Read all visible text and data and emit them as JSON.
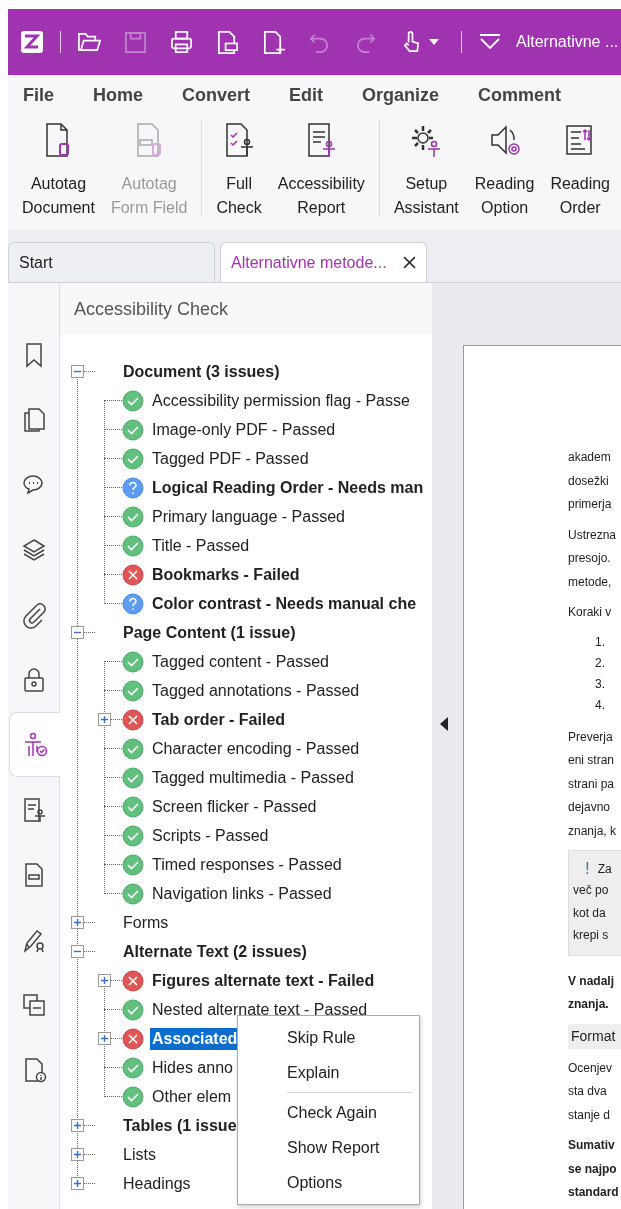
{
  "titlebar": {
    "title": "Alternativne ...",
    "quick_access": [
      {
        "disabled": false
      },
      {
        "disabled": true
      },
      {
        "disabled": false
      },
      {
        "disabled": false
      },
      {
        "disabled": false
      },
      {
        "disabled": true
      },
      {
        "disabled": true
      },
      {
        "disabled": false
      }
    ]
  },
  "menu": [
    "File",
    "Home",
    "Convert",
    "Edit",
    "Organize",
    "Comment"
  ],
  "ribbon": [
    {
      "buttons": [
        {
          "label": "Autotag\nDocument",
          "disabled": false
        },
        {
          "label": "Autotag\nForm Field",
          "disabled": true
        }
      ]
    },
    {
      "buttons": [
        {
          "label": "Full\nCheck",
          "disabled": false
        },
        {
          "label": "Accessibility\nReport",
          "disabled": false
        }
      ]
    },
    {
      "buttons": [
        {
          "label": "Setup\nAssistant",
          "disabled": false
        },
        {
          "label": "Reading\nOption",
          "disabled": false
        },
        {
          "label": "Reading\nOrder",
          "disabled": false
        }
      ]
    }
  ],
  "tabs": [
    {
      "label": "Start",
      "selected": false,
      "closable": false
    },
    {
      "label": "Alternativne metode...",
      "selected": true,
      "closable": true
    }
  ],
  "rail": [
    {
      "selected": false
    },
    {
      "selected": false
    },
    {
      "selected": false
    },
    {
      "selected": false
    },
    {
      "selected": false
    },
    {
      "selected": false
    },
    {
      "selected": true
    },
    {
      "selected": false
    },
    {
      "selected": false
    },
    {
      "selected": false
    },
    {
      "selected": false
    },
    {
      "selected": false
    }
  ],
  "panel": {
    "title": "Accessibility Check",
    "tree": [
      {
        "label": "Document (3 issues)",
        "bold": true,
        "expanded": true,
        "children": [
          {
            "label": "Accessibility permission flag - Passe",
            "kind": "passed",
            "bold": false,
            "selected": false
          },
          {
            "label": "Image-only PDF - Passed",
            "kind": "passed",
            "bold": false,
            "selected": false
          },
          {
            "label": "Tagged PDF - Passed",
            "kind": "passed",
            "bold": false,
            "selected": false
          },
          {
            "label": "Logical Reading Order - Needs man",
            "kind": "manual",
            "bold": true,
            "selected": false
          },
          {
            "label": "Primary language - Passed",
            "kind": "passed",
            "bold": false,
            "selected": false
          },
          {
            "label": "Title - Passed",
            "kind": "passed",
            "bold": false,
            "selected": false
          },
          {
            "label": "Bookmarks - Failed",
            "kind": "failed",
            "bold": true,
            "selected": false
          },
          {
            "label": "Color contrast - Needs manual che",
            "kind": "manual",
            "bold": true,
            "selected": false
          }
        ]
      },
      {
        "label": "Page Content (1 issue)",
        "bold": true,
        "expanded": true,
        "children": [
          {
            "label": "Tagged content - Passed",
            "kind": "passed",
            "bold": false,
            "selected": false
          },
          {
            "label": "Tagged annotations - Passed",
            "kind": "passed",
            "bold": false,
            "selected": false
          },
          {
            "label": "Tab order - Failed",
            "kind": "failed",
            "bold": true,
            "selected": false,
            "expanded": false
          },
          {
            "label": "Character encoding - Passed",
            "kind": "passed",
            "bold": false,
            "selected": false
          },
          {
            "label": "Tagged multimedia - Passed",
            "kind": "passed",
            "bold": false,
            "selected": false
          },
          {
            "label": "Screen flicker - Passed",
            "kind": "passed",
            "bold": false,
            "selected": false
          },
          {
            "label": "Scripts - Passed",
            "kind": "passed",
            "bold": false,
            "selected": false
          },
          {
            "label": "Timed responses - Passed",
            "kind": "passed",
            "bold": false,
            "selected": false
          },
          {
            "label": "Navigation links - Passed",
            "kind": "passed",
            "bold": false,
            "selected": false
          }
        ]
      },
      {
        "label": "Forms",
        "bold": false,
        "expanded": false
      },
      {
        "label": "Alternate Text (2 issues)",
        "bold": true,
        "expanded": true,
        "children": [
          {
            "label": "Figures alternate text - Failed",
            "kind": "failed",
            "bold": true,
            "selected": false,
            "expanded": false
          },
          {
            "label": "Nested alternate text - Passed",
            "kind": "passed",
            "bold": false,
            "selected": false
          },
          {
            "label": "Associated",
            "kind": "failed",
            "bold": true,
            "selected": true,
            "expanded": false
          },
          {
            "label": "Hides anno",
            "kind": "passed",
            "bold": false,
            "selected": false
          },
          {
            "label": "Other elem",
            "kind": "passed",
            "bold": false,
            "selected": false
          }
        ]
      },
      {
        "label": "Tables (1 issue",
        "bold": true,
        "expanded": false
      },
      {
        "label": "Lists",
        "bold": false,
        "expanded": false
      },
      {
        "label": "Headings",
        "bold": false,
        "expanded": false
      }
    ]
  },
  "context_menu": {
    "items": [
      {
        "label": "Skip Rule",
        "separator_after": false
      },
      {
        "label": "Explain",
        "separator_after": true
      },
      {
        "label": "Check Again",
        "separator_after": false
      },
      {
        "label": "Show Report",
        "separator_after": false
      },
      {
        "label": "Options",
        "separator_after": false
      }
    ]
  },
  "document": {
    "blocks": [
      {
        "kind": "paragraph",
        "bold": false,
        "lines": [
          "akadem",
          "dosežki",
          "primerja"
        ]
      },
      {
        "kind": "paragraph",
        "bold": false,
        "lines": [
          "Ustrezna",
          "presojo.",
          "metode,"
        ]
      },
      {
        "kind": "paragraph",
        "bold": false,
        "lines": [
          "Koraki v"
        ]
      },
      {
        "kind": "list",
        "lines": [
          "1.",
          "2.",
          "3.",
          "4."
        ]
      },
      {
        "kind": "paragraph",
        "bold": false,
        "lines": [
          "Preverja",
          "eni stran",
          "strani pa",
          "dejavno",
          "znanja, k"
        ]
      },
      {
        "kind": "note",
        "mark": "!",
        "lines": [
          "Za",
          "več po",
          "kot da",
          "krepi s"
        ]
      },
      {
        "kind": "paragraph",
        "bold": true,
        "lines": [
          "V nadalj",
          "znanja."
        ]
      },
      {
        "kind": "heading",
        "lines": [
          "Format"
        ]
      },
      {
        "kind": "paragraph",
        "bold": false,
        "lines": [
          "Ocenjev",
          "sta dva",
          "stanje d"
        ]
      },
      {
        "kind": "paragraph",
        "bold": true,
        "lines": [
          "Sumativ",
          "se najpo",
          "standard"
        ]
      }
    ]
  }
}
